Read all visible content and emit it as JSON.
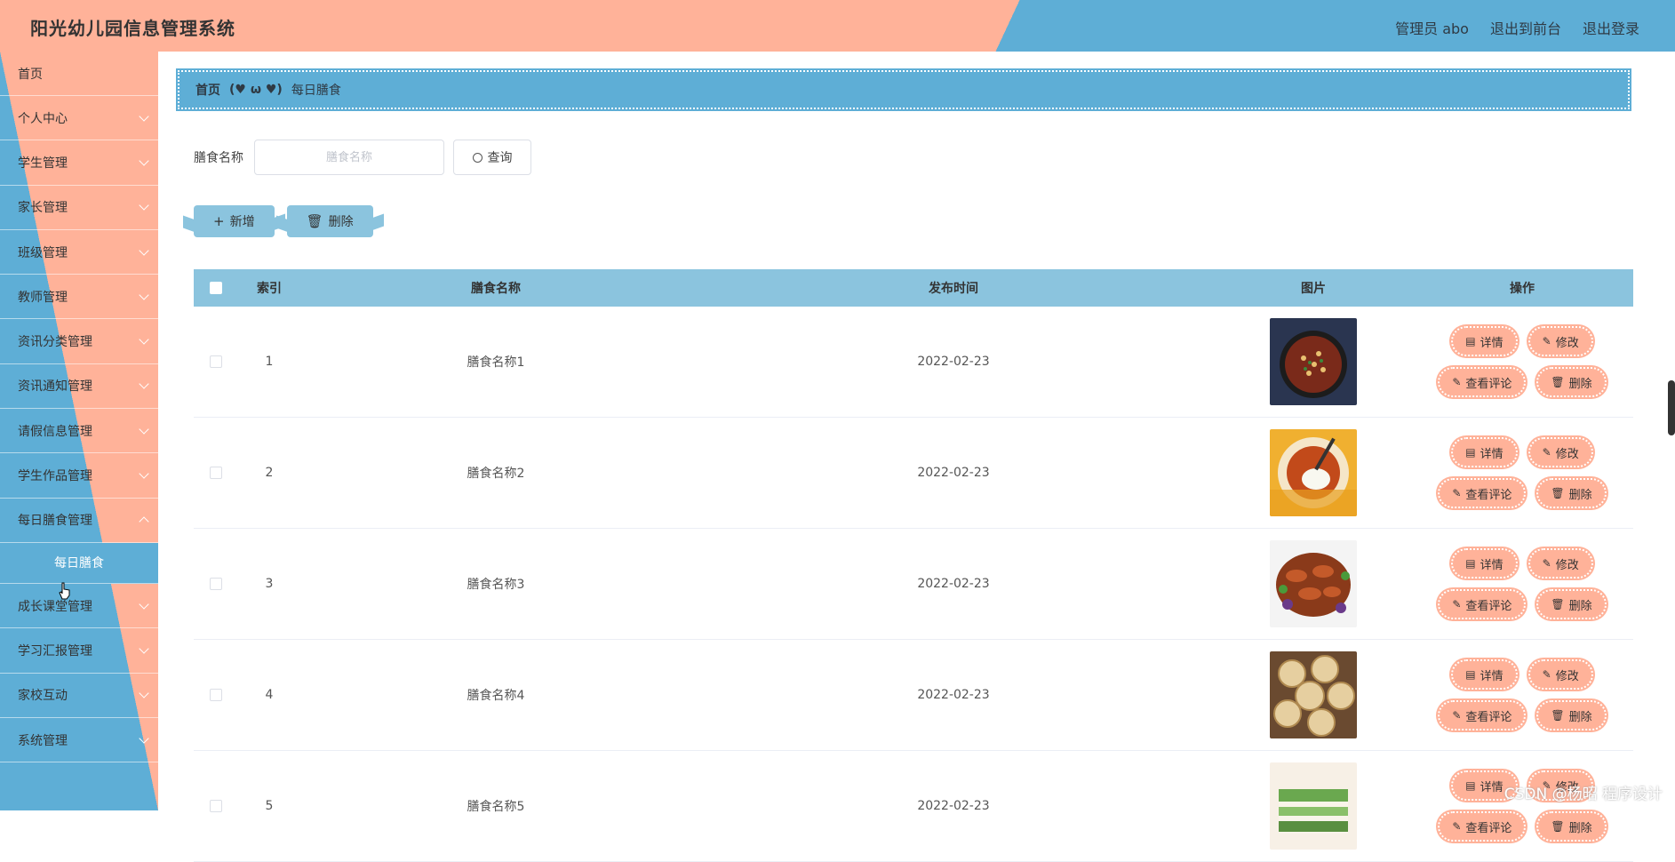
{
  "app": {
    "title": "阳光幼儿园信息管理系统"
  },
  "header": {
    "user": "管理员 abo",
    "to_front": "退出到前台",
    "logout": "退出登录"
  },
  "sidebar": {
    "items": [
      {
        "label": "首页"
      },
      {
        "label": "个人中心"
      },
      {
        "label": "学生管理"
      },
      {
        "label": "家长管理"
      },
      {
        "label": "班级管理"
      },
      {
        "label": "教师管理"
      },
      {
        "label": "资讯分类管理"
      },
      {
        "label": "资讯通知管理"
      },
      {
        "label": "请假信息管理"
      },
      {
        "label": "学生作品管理"
      },
      {
        "label": "每日膳食管理"
      }
    ],
    "active_sub": "每日膳食",
    "items_after": [
      {
        "label": "成长课堂管理"
      },
      {
        "label": "学习汇报管理"
      },
      {
        "label": "家校互动"
      },
      {
        "label": "系统管理"
      }
    ]
  },
  "breadcrumb": {
    "home": "首页",
    "separator": "(♥ ω ♥)",
    "current": "每日膳食"
  },
  "search": {
    "label": "膳食名称",
    "placeholder": "膳食名称",
    "button": "查询"
  },
  "actions": {
    "add": "新增",
    "delete": "删除"
  },
  "table": {
    "columns": {
      "index": "索引",
      "name": "膳食名称",
      "time": "发布时间",
      "image": "图片",
      "ops": "操作"
    },
    "rows": [
      {
        "index": "1",
        "name": "膳食名称1",
        "time": "2022-02-23"
      },
      {
        "index": "2",
        "name": "膳食名称2",
        "time": "2022-02-23"
      },
      {
        "index": "3",
        "name": "膳食名称3",
        "time": "2022-02-23"
      },
      {
        "index": "4",
        "name": "膳食名称4",
        "time": "2022-02-23"
      },
      {
        "index": "5",
        "name": "膳食名称5",
        "time": "2022-02-23"
      }
    ],
    "ops": {
      "detail": "详情",
      "edit": "修改",
      "comments": "查看评论",
      "delete": "删除"
    }
  },
  "watermark": "CSDN @杨昭 程序设计",
  "colors": {
    "peach": "#ffb299",
    "blue": "#5eaed6",
    "light_blue": "#8bc4de"
  }
}
